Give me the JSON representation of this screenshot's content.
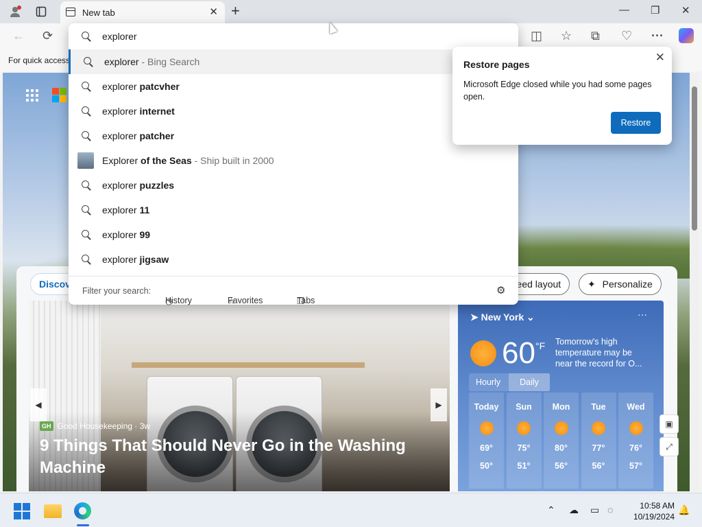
{
  "tab": {
    "title": "New tab"
  },
  "omnibox": {
    "query": "explorer",
    "suggestions": [
      {
        "prefix": "explorer",
        "bold": "",
        "hint": " - Bing Search"
      },
      {
        "prefix": "explorer ",
        "bold": "patcvher",
        "hint": ""
      },
      {
        "prefix": "explorer ",
        "bold": "internet",
        "hint": ""
      },
      {
        "prefix": "explorer ",
        "bold": "patcher",
        "hint": ""
      },
      {
        "prefix": "Explorer ",
        "bold": "of the Seas",
        "hint": " - Ship built in 2000"
      },
      {
        "prefix": "explorer ",
        "bold": "puzzles",
        "hint": ""
      },
      {
        "prefix": "explorer ",
        "bold": "11",
        "hint": ""
      },
      {
        "prefix": "explorer ",
        "bold": "99",
        "hint": ""
      },
      {
        "prefix": "explorer ",
        "bold": "jigsaw",
        "hint": ""
      }
    ],
    "filter_label": "Filter your search:",
    "filters": [
      "History",
      "Favorites",
      "Tabs"
    ]
  },
  "favorites_bar": {
    "text": "For quick access"
  },
  "restore": {
    "title": "Restore pages",
    "message": "Microsoft Edge closed while you had some pages open.",
    "button": "Restore"
  },
  "feed": {
    "discover": "Discov",
    "feed_layout": "Feed layout",
    "personalize": "Personalize",
    "hero": {
      "source": "Good Housekeeping · 3w",
      "source_badge": "GH",
      "headline": "9 Things That Should Never Go in the Washing Machine"
    }
  },
  "weather": {
    "city": "New York",
    "temp": "60",
    "unit": "°F",
    "alert": "Tomorrow's high temperature may be near the record for O...",
    "tab_hourly": "Hourly",
    "tab_daily": "Daily",
    "days": [
      {
        "name": "Today",
        "hi": "69°",
        "lo": "50°"
      },
      {
        "name": "Sun",
        "hi": "75°",
        "lo": "51°"
      },
      {
        "name": "Mon",
        "hi": "80°",
        "lo": "56°"
      },
      {
        "name": "Tue",
        "hi": "77°",
        "lo": "56°"
      },
      {
        "name": "Wed",
        "hi": "76°",
        "lo": "57°"
      }
    ]
  },
  "taskbar": {
    "time": "10:58 AM",
    "date": "10/19/2024"
  },
  "colors": {
    "accent": "#0f6cbd",
    "weather_bg": "#3e6bb8"
  }
}
